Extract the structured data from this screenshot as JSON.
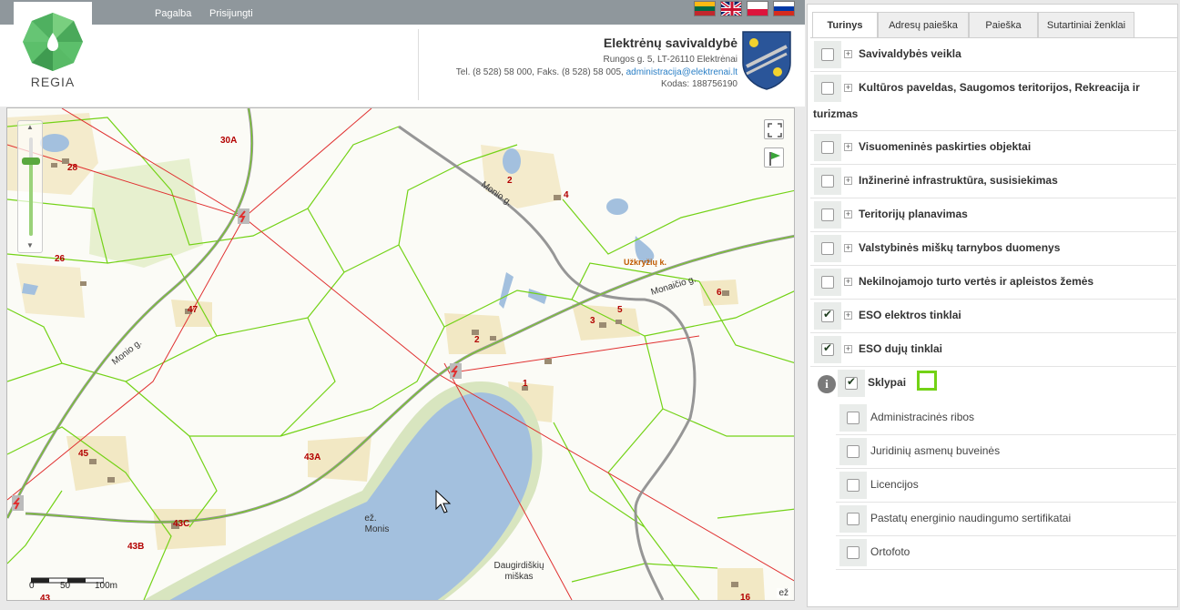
{
  "topbar": {
    "nav": [
      "Pagalba",
      "Prisijungti"
    ],
    "flags": [
      "lt-flag-icon",
      "uk-flag-icon",
      "pl-flag-icon",
      "ru-flag-icon"
    ]
  },
  "header": {
    "logo_text": "REGIA",
    "municipality": "Elektrėnų savivaldybė",
    "address_line": "Rungos g. 5, LT-26110 Elektrėnai",
    "phone_line": "Tel. (8 528) 58 000, Faks. (8 528) 58 005,",
    "email": "administracija@elektrenai.lt",
    "code_line": "Kodas: 188756190"
  },
  "map": {
    "labels": [
      {
        "text": "30A"
      },
      {
        "text": "28"
      },
      {
        "text": "26"
      },
      {
        "text": "47"
      },
      {
        "text": "45"
      },
      {
        "text": "43A"
      },
      {
        "text": "43C"
      },
      {
        "text": "43B"
      },
      {
        "text": "43"
      },
      {
        "text": "2"
      },
      {
        "text": "4"
      },
      {
        "text": "2"
      },
      {
        "text": "3"
      },
      {
        "text": "5"
      },
      {
        "text": "6"
      },
      {
        "text": "1"
      },
      {
        "text": "16"
      }
    ],
    "streets": [
      "Monio g.",
      "Monio g.",
      "Monaičio g."
    ],
    "place_label": "Užkryžių k.",
    "lake_name_1": "ež.",
    "lake_name_2": "Monis",
    "forest_1": "Daugirdiškių",
    "forest_2": "miškas",
    "scale": {
      "zero": "0",
      "mid": "50",
      "end": "100m"
    },
    "corner_label": "ež"
  },
  "panel": {
    "tabs": [
      "Turinys",
      "Adresų paieška",
      "Paieška",
      "Sutartiniai ženklai"
    ],
    "active_tab": 0,
    "layers": [
      {
        "label": "Savivaldybės veikla",
        "checked": false
      },
      {
        "label": "Kultūros paveldas, Saugomos teritorijos, Rekreacija ir",
        "label2": "turizmas",
        "checked": false
      },
      {
        "label": "Visuomeninės paskirties objektai",
        "checked": false
      },
      {
        "label": "Inžinerinė infrastruktūra, susisiekimas",
        "checked": false
      },
      {
        "label": "Teritorijų planavimas",
        "checked": false
      },
      {
        "label": "Valstybinės miškų tarnybos duomenys",
        "checked": false
      },
      {
        "label": "Nekilnojamojo turto vertės ir apleistos žemės",
        "checked": false
      },
      {
        "label": "ESO elektros tinklai",
        "checked": true
      },
      {
        "label": "ESO dujų tinklai",
        "checked": true
      }
    ],
    "active_layer": {
      "label": "Sklypai",
      "checked": true
    },
    "sublayers": [
      {
        "label": "Administracinės ribos",
        "checked": false
      },
      {
        "label": "Juridinių asmenų buveinės",
        "checked": false
      },
      {
        "label": "Licencijos",
        "checked": false
      },
      {
        "label": "Pastatų energinio naudingumo sertifikatai",
        "checked": false
      },
      {
        "label": "Ortofoto",
        "checked": false
      }
    ],
    "colors": {
      "plot_outline": "#73d216",
      "power_line": "#e03030",
      "gas_line": "#8c8c8c",
      "lake": "#a3c0de"
    }
  }
}
